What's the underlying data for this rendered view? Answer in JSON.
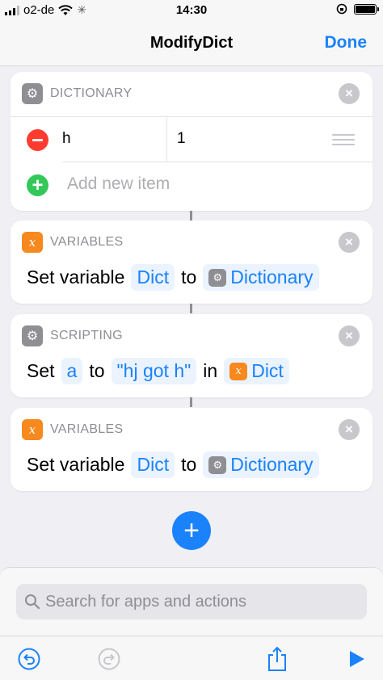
{
  "status_bar": {
    "carrier": "o2-de",
    "time": "14:30"
  },
  "nav": {
    "title": "ModifyDict",
    "done_label": "Done"
  },
  "actions": [
    {
      "category": "DICTIONARY",
      "icon": "gear-icon",
      "rows": [
        {
          "key": "h",
          "value": "1"
        }
      ],
      "add_label": "Add new item"
    },
    {
      "category": "VARIABLES",
      "icon": "variable-x-icon",
      "words": [
        "Set variable",
        "to"
      ],
      "var_name": "Dict",
      "source": "Dictionary"
    },
    {
      "category": "SCRIPTING",
      "icon": "gear-icon",
      "words": [
        "Set",
        "to",
        "in"
      ],
      "key": "a",
      "value": "\"hj got h\"",
      "target": "Dict"
    },
    {
      "category": "VARIABLES",
      "icon": "variable-x-icon",
      "words": [
        "Set variable",
        "to"
      ],
      "var_name": "Dict",
      "source": "Dictionary"
    }
  ],
  "search": {
    "placeholder": "Search for apps and actions"
  },
  "colors": {
    "accent": "#1a82fb",
    "remove": "#ff3b30",
    "add": "#34c759",
    "variables": "#f7891f"
  }
}
